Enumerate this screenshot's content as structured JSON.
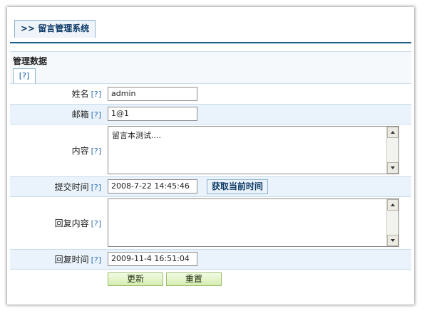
{
  "header": {
    "title": ">> 留言管理系统"
  },
  "section": {
    "title": "管理数据",
    "help": "[?]"
  },
  "form": {
    "help_mark": "[?]",
    "fields": {
      "name": {
        "label": "姓名",
        "value": "admin"
      },
      "email": {
        "label": "邮箱",
        "value": "1@1"
      },
      "content": {
        "label": "内容",
        "value": "留言本测试...."
      },
      "submit_time": {
        "label": "提交时间",
        "value": "2008-7-22 14:45:46",
        "button": "获取当前时间"
      },
      "reply_content": {
        "label": "回复内容",
        "value": ""
      },
      "reply_time": {
        "label": "回复时间",
        "value": "2009-11-4 16:51:04"
      }
    },
    "buttons": {
      "update": "更新",
      "reset": "重置"
    }
  }
}
